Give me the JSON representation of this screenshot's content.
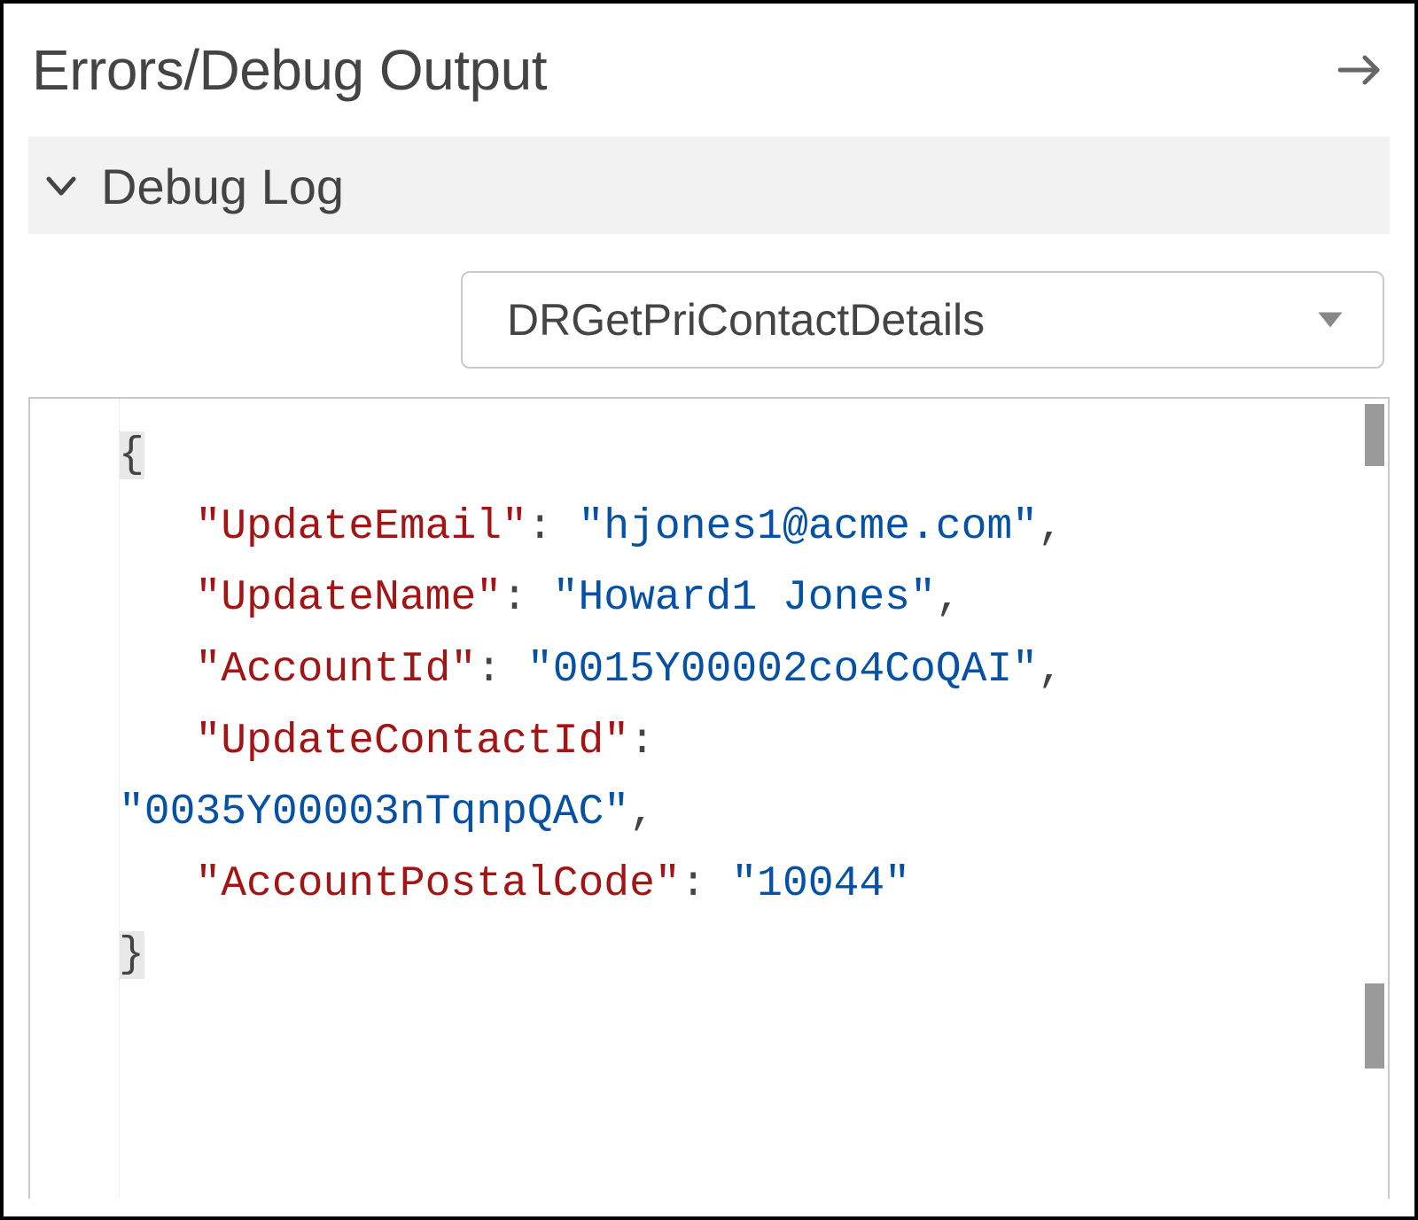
{
  "header": {
    "title": "Errors/Debug Output"
  },
  "section": {
    "title": "Debug Log"
  },
  "select": {
    "value": "DRGetPriContactDetails"
  },
  "json_output": {
    "UpdateEmail": "hjones1@acme.com",
    "UpdateName": "Howard1 Jones",
    "AccountId": "0015Y00002co4CoQAI",
    "UpdateContactId": "0035Y00003nTqnpQAC",
    "AccountPostalCode": "10044"
  },
  "code": {
    "open_brace": "{",
    "close_brace": "}",
    "indent": "   ",
    "kv1_k": "\"UpdateEmail\"",
    "kv1_sep": ": ",
    "kv1_v": "\"hjones1@acme.com\"",
    "kv2_k": "\"UpdateName\"",
    "kv2_sep": ": ",
    "kv2_v": "\"Howard1 Jones\"",
    "kv3_k": "\"AccountId\"",
    "kv3_sep": ": ",
    "kv3_v": "\"0015Y00002co4CoQAI\"",
    "kv4_k": "\"UpdateContactId\"",
    "kv4_sep": ":",
    "kv4_v": "\"0035Y00003nTqnpQAC\"",
    "kv5_k": "\"AccountPostalCode\"",
    "kv5_sep": ": ",
    "kv5_v": "\"10044\"",
    "comma": ","
  }
}
